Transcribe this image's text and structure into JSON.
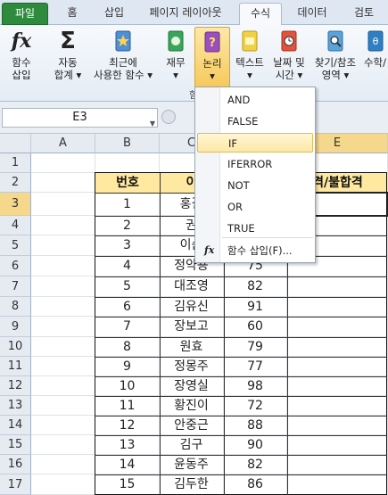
{
  "ribbon_tabs": [
    "파일",
    "홈",
    "삽입",
    "페이지 레이아웃",
    "수식",
    "데이터",
    "검토"
  ],
  "ribbon_buttons": {
    "insert_function": [
      "함수",
      "삽입"
    ],
    "autosum": [
      "자동",
      "합계 ▾"
    ],
    "recent": [
      "최근에",
      "사용한 함수 ▾"
    ],
    "financial": [
      "재무",
      "▾"
    ],
    "logical": [
      "논리",
      "▾"
    ],
    "text": [
      "텍스트",
      "▾"
    ],
    "datetime": [
      "날짜 및",
      "시간 ▾"
    ],
    "lookup": [
      "찾기/참조",
      "영역 ▾"
    ],
    "math": [
      "수학/",
      ""
    ]
  },
  "group_label": "함",
  "name_box": "E3",
  "column_headers": [
    "A",
    "B",
    "C",
    "D",
    "E"
  ],
  "row_headers": [
    "1",
    "2",
    "3",
    "4",
    "5",
    "6",
    "7",
    "8",
    "9",
    "10",
    "11",
    "12",
    "13",
    "14",
    "15",
    "16",
    "17"
  ],
  "table": {
    "header_no": "번호",
    "header_name": "이",
    "header_result": "격/불합격",
    "numbers": [
      "1",
      "2",
      "3",
      "4",
      "5",
      "6",
      "7",
      "8",
      "9",
      "10",
      "11",
      "12",
      "13",
      "14",
      "15"
    ],
    "names": [
      "홍길",
      "권",
      "이순",
      "정약용",
      "대조영",
      "김유신",
      "장보고",
      "원효",
      "정몽주",
      "장영실",
      "황진이",
      "안중근",
      "김구",
      "윤동주",
      "김두한"
    ],
    "scores": [
      "",
      "",
      "",
      "75",
      "82",
      "91",
      "60",
      "79",
      "77",
      "98",
      "72",
      "88",
      "90",
      "82",
      "86"
    ]
  },
  "logical_menu": {
    "items": [
      "AND",
      "FALSE",
      "IF",
      "IFERROR",
      "NOT",
      "OR",
      "TRUE"
    ],
    "highlighted": "IF",
    "insert_function_label": "함수 삽입(F)..."
  },
  "colors": {
    "file_tab": "#2e8b3e",
    "header_fill": "#ffe8a0",
    "selection_header": "#f5d88b",
    "menu_highlight": "#fde8a6"
  }
}
